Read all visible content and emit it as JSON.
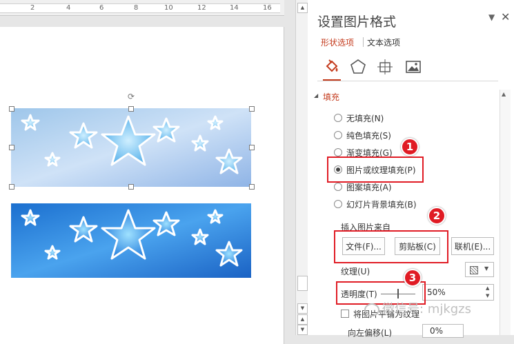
{
  "ruler": {
    "numbers": [
      "2",
      "4",
      "6",
      "8",
      "10",
      "12",
      "14",
      "16"
    ]
  },
  "pane": {
    "title": "设置图片格式",
    "tabs": {
      "shape": "形状选项",
      "text": "文本选项"
    },
    "section": "填充",
    "fill_options": [
      {
        "label": "无填充(N)",
        "selected": false
      },
      {
        "label": "纯色填充(S)",
        "selected": false
      },
      {
        "label": "渐变填充(G)",
        "selected": false
      },
      {
        "label": "图片或纹理填充(P)",
        "selected": true
      },
      {
        "label": "图案填充(A)",
        "selected": false
      },
      {
        "label": "幻灯片背景填充(B)",
        "selected": false
      }
    ],
    "insert_from": "插入图片来自",
    "buttons": {
      "file": "文件(F)...",
      "clipboard": "剪贴板(C)",
      "online": "联机(E)..."
    },
    "texture_label": "纹理(U)",
    "transparency_label": "透明度(T)",
    "transparency_value": "50%",
    "tile_label": "将图片平铺为纹理",
    "offset_label": "向左偏移(L)",
    "offset_value": "0%"
  },
  "badges": [
    "1",
    "2",
    "3"
  ],
  "watermark": "微信号: mjkgzs",
  "colors": {
    "accent": "#c43b1d",
    "annotation": "#e01b24"
  }
}
